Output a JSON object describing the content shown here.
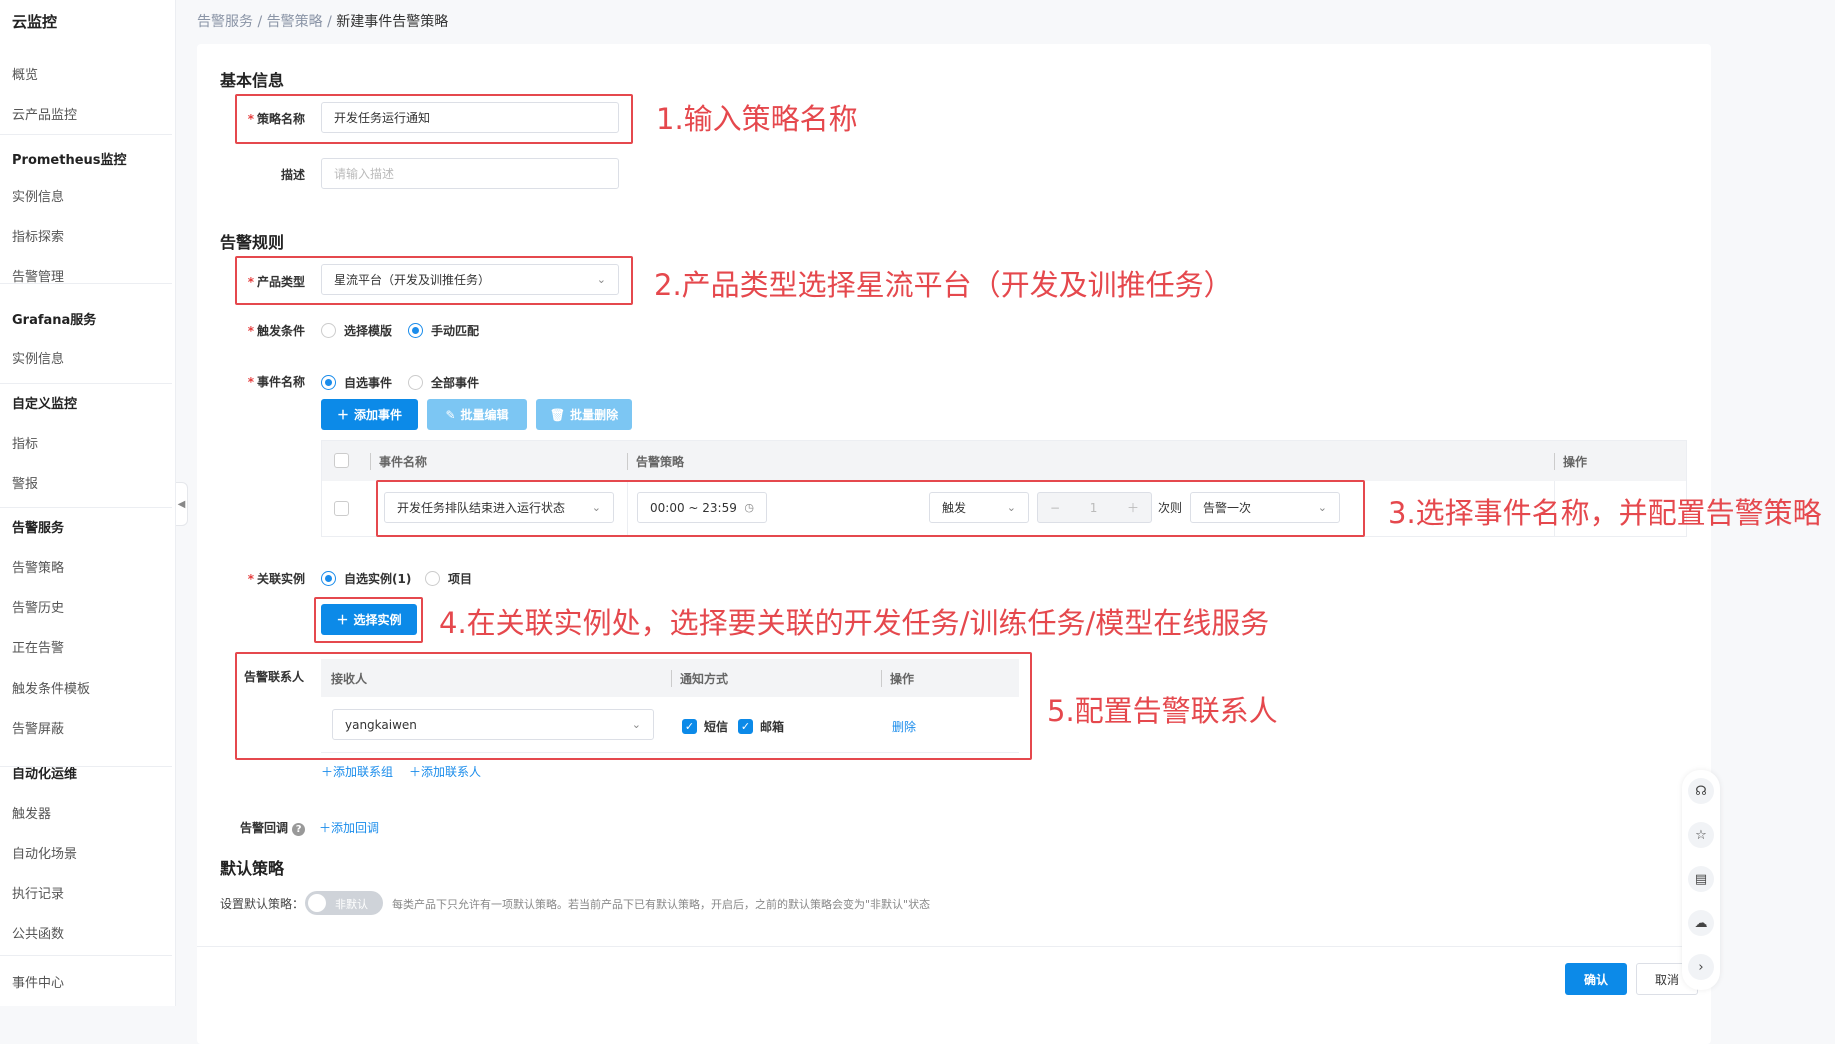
{
  "sidebar": {
    "title": "云监控",
    "items": [
      {
        "label": "概览"
      },
      {
        "label": "云产品监控"
      },
      {
        "label": "Prometheus监控",
        "group": true
      },
      {
        "label": "实例信息"
      },
      {
        "label": "指标探索"
      },
      {
        "label": "告警管理"
      },
      {
        "label": "Grafana服务",
        "group": true
      },
      {
        "label": "实例信息"
      },
      {
        "label": "自定义监控",
        "group": true
      },
      {
        "label": "指标"
      },
      {
        "label": "警报"
      },
      {
        "label": "告警服务",
        "group": true
      },
      {
        "label": "告警策略"
      },
      {
        "label": "告警历史"
      },
      {
        "label": "正在告警"
      },
      {
        "label": "触发条件模板"
      },
      {
        "label": "告警屏蔽"
      },
      {
        "label": "自动化运维",
        "group": true
      },
      {
        "label": "触发器"
      },
      {
        "label": "自动化场景"
      },
      {
        "label": "执行记录"
      },
      {
        "label": "公共函数"
      },
      {
        "label": "事件中心"
      }
    ]
  },
  "breadcrumb": [
    "告警服务",
    "告警策略",
    "新建事件告警策略"
  ],
  "basic": {
    "title": "基本信息",
    "name_label": "策略名称",
    "name_value": "开发任务运行通知",
    "desc_label": "描述",
    "desc_placeholder": "请输入描述"
  },
  "rules": {
    "title": "告警规则",
    "product_label": "产品类型",
    "product_value": "星流平台（开发及训推任务）",
    "trigger_label": "触发条件",
    "trigger_options": [
      "选择模版",
      "手动匹配"
    ],
    "trigger_selected": "手动匹配",
    "event_label": "事件名称",
    "event_options": [
      "自选事件",
      "全部事件"
    ],
    "event_selected": "自选事件",
    "buttons": {
      "add": "添加事件",
      "batch_edit": "批量编辑",
      "batch_delete": "批量删除"
    },
    "table": {
      "headers": [
        "事件名称",
        "告警策略",
        "操作"
      ],
      "row": {
        "event": "开发任务排队结束进入运行状态",
        "time": "00:00 ~ 23:59",
        "mode": "触发",
        "count": "1",
        "unit": "次则",
        "action": "告警一次"
      }
    },
    "instance_label": "关联实例",
    "instance_options": [
      "自选实例(1)",
      "项目"
    ],
    "instance_selected": "自选实例(1)",
    "select_instance": "选择实例",
    "contacts_label": "告警联系人",
    "contacts_headers": [
      "接收人",
      "通知方式",
      "操作"
    ],
    "contact": {
      "name": "yangkaiwen",
      "sms": "短信",
      "email": "邮箱",
      "sms_checked": true,
      "email_checked": true,
      "delete": "删除"
    },
    "add_group": "添加联系组",
    "add_contact": "添加联系人",
    "callback_label": "告警回调",
    "add_callback": "添加回调"
  },
  "default": {
    "title": "默认策略",
    "label": "设置默认策略：",
    "toggle": "非默认",
    "toggle_on": false,
    "hint": "每类产品下只允许有一项默认策略。若当前产品下已有默认策略，开启后，之前的默认策略会变为\"非默认\"状态"
  },
  "footer": {
    "confirm": "确认",
    "cancel": "取消"
  },
  "annotations": [
    "1.输入策略名称",
    "2.产品类型选择星流平台（开发及训推任务）",
    "3.选择事件名称，并配置告警策略",
    "4.在关联实例处，选择要关联的开发任务/训练任务/模型在线服务",
    "5.配置告警联系人"
  ],
  "colors": {
    "accent": "#0c8ae8",
    "annotation": "#e5484d"
  }
}
